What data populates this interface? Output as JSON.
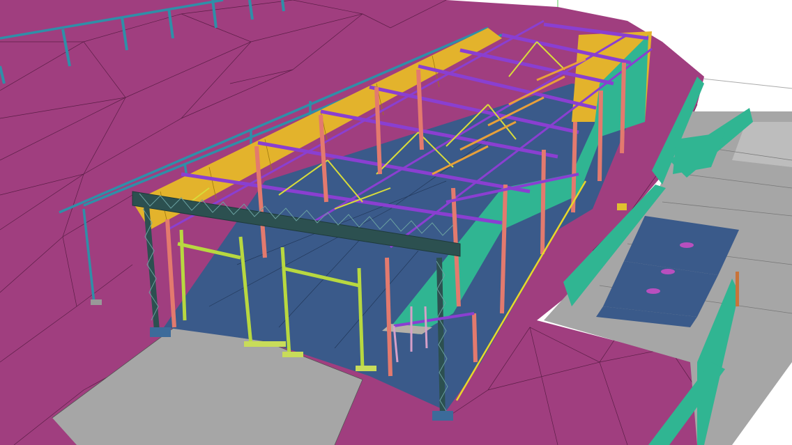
{
  "scene": {
    "colors": {
      "terrain": "#a03e7f",
      "terrain_edge": "#5a1e46",
      "sky": "#ffffff",
      "slab": "#3a5a8a",
      "concrete": "#a6a6a6",
      "teal_panel": "#30b592",
      "column": "#e37a6e",
      "beam": "#8a3fd1",
      "truss": "#2c5050",
      "brace": "#d8dc3a",
      "cladding": "#e3b32c",
      "canopy": "#2f8fa8",
      "opening": "#b84fbe"
    },
    "icons": [
      "steel-frame-model"
    ]
  }
}
